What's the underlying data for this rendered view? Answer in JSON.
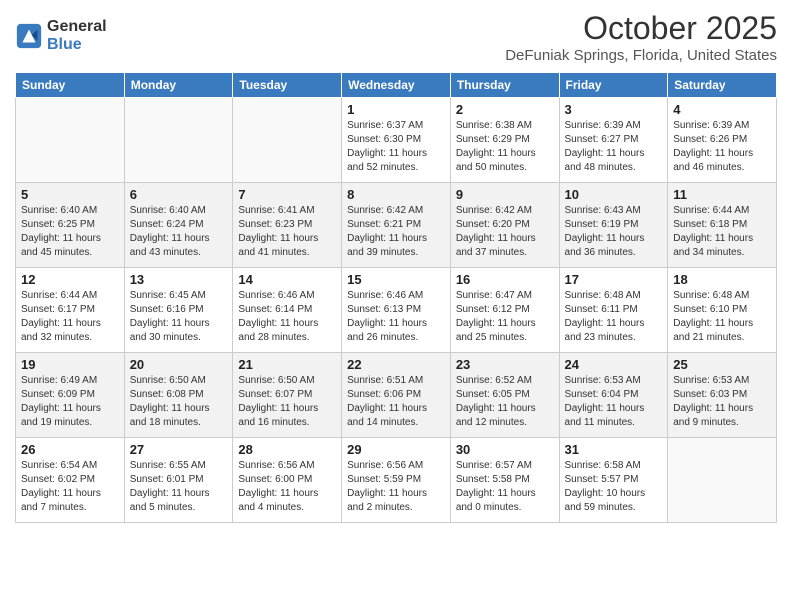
{
  "logo": {
    "general": "General",
    "blue": "Blue"
  },
  "title": "October 2025",
  "location": "DeFuniak Springs, Florida, United States",
  "days_of_week": [
    "Sunday",
    "Monday",
    "Tuesday",
    "Wednesday",
    "Thursday",
    "Friday",
    "Saturday"
  ],
  "weeks": [
    [
      {
        "day": "",
        "info": ""
      },
      {
        "day": "",
        "info": ""
      },
      {
        "day": "",
        "info": ""
      },
      {
        "day": "1",
        "info": "Sunrise: 6:37 AM\nSunset: 6:30 PM\nDaylight: 11 hours and 52 minutes."
      },
      {
        "day": "2",
        "info": "Sunrise: 6:38 AM\nSunset: 6:29 PM\nDaylight: 11 hours and 50 minutes."
      },
      {
        "day": "3",
        "info": "Sunrise: 6:39 AM\nSunset: 6:27 PM\nDaylight: 11 hours and 48 minutes."
      },
      {
        "day": "4",
        "info": "Sunrise: 6:39 AM\nSunset: 6:26 PM\nDaylight: 11 hours and 46 minutes."
      }
    ],
    [
      {
        "day": "5",
        "info": "Sunrise: 6:40 AM\nSunset: 6:25 PM\nDaylight: 11 hours and 45 minutes."
      },
      {
        "day": "6",
        "info": "Sunrise: 6:40 AM\nSunset: 6:24 PM\nDaylight: 11 hours and 43 minutes."
      },
      {
        "day": "7",
        "info": "Sunrise: 6:41 AM\nSunset: 6:23 PM\nDaylight: 11 hours and 41 minutes."
      },
      {
        "day": "8",
        "info": "Sunrise: 6:42 AM\nSunset: 6:21 PM\nDaylight: 11 hours and 39 minutes."
      },
      {
        "day": "9",
        "info": "Sunrise: 6:42 AM\nSunset: 6:20 PM\nDaylight: 11 hours and 37 minutes."
      },
      {
        "day": "10",
        "info": "Sunrise: 6:43 AM\nSunset: 6:19 PM\nDaylight: 11 hours and 36 minutes."
      },
      {
        "day": "11",
        "info": "Sunrise: 6:44 AM\nSunset: 6:18 PM\nDaylight: 11 hours and 34 minutes."
      }
    ],
    [
      {
        "day": "12",
        "info": "Sunrise: 6:44 AM\nSunset: 6:17 PM\nDaylight: 11 hours and 32 minutes."
      },
      {
        "day": "13",
        "info": "Sunrise: 6:45 AM\nSunset: 6:16 PM\nDaylight: 11 hours and 30 minutes."
      },
      {
        "day": "14",
        "info": "Sunrise: 6:46 AM\nSunset: 6:14 PM\nDaylight: 11 hours and 28 minutes."
      },
      {
        "day": "15",
        "info": "Sunrise: 6:46 AM\nSunset: 6:13 PM\nDaylight: 11 hours and 26 minutes."
      },
      {
        "day": "16",
        "info": "Sunrise: 6:47 AM\nSunset: 6:12 PM\nDaylight: 11 hours and 25 minutes."
      },
      {
        "day": "17",
        "info": "Sunrise: 6:48 AM\nSunset: 6:11 PM\nDaylight: 11 hours and 23 minutes."
      },
      {
        "day": "18",
        "info": "Sunrise: 6:48 AM\nSunset: 6:10 PM\nDaylight: 11 hours and 21 minutes."
      }
    ],
    [
      {
        "day": "19",
        "info": "Sunrise: 6:49 AM\nSunset: 6:09 PM\nDaylight: 11 hours and 19 minutes."
      },
      {
        "day": "20",
        "info": "Sunrise: 6:50 AM\nSunset: 6:08 PM\nDaylight: 11 hours and 18 minutes."
      },
      {
        "day": "21",
        "info": "Sunrise: 6:50 AM\nSunset: 6:07 PM\nDaylight: 11 hours and 16 minutes."
      },
      {
        "day": "22",
        "info": "Sunrise: 6:51 AM\nSunset: 6:06 PM\nDaylight: 11 hours and 14 minutes."
      },
      {
        "day": "23",
        "info": "Sunrise: 6:52 AM\nSunset: 6:05 PM\nDaylight: 11 hours and 12 minutes."
      },
      {
        "day": "24",
        "info": "Sunrise: 6:53 AM\nSunset: 6:04 PM\nDaylight: 11 hours and 11 minutes."
      },
      {
        "day": "25",
        "info": "Sunrise: 6:53 AM\nSunset: 6:03 PM\nDaylight: 11 hours and 9 minutes."
      }
    ],
    [
      {
        "day": "26",
        "info": "Sunrise: 6:54 AM\nSunset: 6:02 PM\nDaylight: 11 hours and 7 minutes."
      },
      {
        "day": "27",
        "info": "Sunrise: 6:55 AM\nSunset: 6:01 PM\nDaylight: 11 hours and 5 minutes."
      },
      {
        "day": "28",
        "info": "Sunrise: 6:56 AM\nSunset: 6:00 PM\nDaylight: 11 hours and 4 minutes."
      },
      {
        "day": "29",
        "info": "Sunrise: 6:56 AM\nSunset: 5:59 PM\nDaylight: 11 hours and 2 minutes."
      },
      {
        "day": "30",
        "info": "Sunrise: 6:57 AM\nSunset: 5:58 PM\nDaylight: 11 hours and 0 minutes."
      },
      {
        "day": "31",
        "info": "Sunrise: 6:58 AM\nSunset: 5:57 PM\nDaylight: 10 hours and 59 minutes."
      },
      {
        "day": "",
        "info": ""
      }
    ]
  ]
}
